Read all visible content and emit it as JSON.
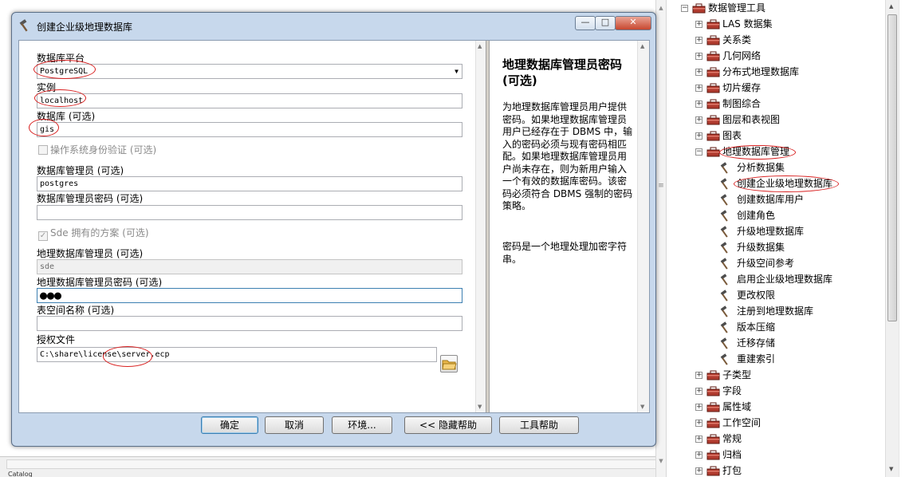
{
  "dialog": {
    "title": "创建企业级地理数据库",
    "window_buttons": {
      "minimize": "—",
      "maximize": "□",
      "close": "✕"
    },
    "fields": {
      "platform": {
        "label": "数据库平台",
        "value": "PostgreSQL"
      },
      "instance": {
        "label": "实例",
        "value": "localhost"
      },
      "database": {
        "label": "数据库 (可选)",
        "value": "gis"
      },
      "os_auth": {
        "label": "操作系统身份验证 (可选)",
        "checked": false
      },
      "db_admin": {
        "label": "数据库管理员 (可选)",
        "value": "postgres"
      },
      "db_admin_password": {
        "label": "数据库管理员密码 (可选)",
        "value": ""
      },
      "sde_schema": {
        "label": "Sde 拥有的方案 (可选)",
        "checked": true
      },
      "gdb_admin": {
        "label": "地理数据库管理员 (可选)",
        "value": "sde"
      },
      "gdb_admin_password": {
        "label": "地理数据库管理员密码 (可选)",
        "value": "●●●"
      },
      "tablespace": {
        "label": "表空间名称 (可选)",
        "value": ""
      },
      "license_file": {
        "label": "授权文件",
        "value": "C:\\share\\license\\server.ecp"
      }
    },
    "help": {
      "title": "地理数据库管理员密码 (可选)",
      "paragraph1": "为地理数据库管理员用户提供密码。如果地理数据库管理员用户已经存在于 DBMS 中，输入的密码必须与现有密码相匹配。如果地理数据库管理员用户尚未存在，则为新用户输入一个有效的数据库密码。该密码必须符合 DBMS 强制的密码策略。",
      "paragraph2": "密码是一个地理处理加密字符串。"
    },
    "buttons": {
      "ok": "确定",
      "cancel": "取消",
      "environments": "环境...",
      "hide_help": "<< 隐藏帮助",
      "tool_help": "工具帮助"
    }
  },
  "tree": {
    "root": "数据管理工具",
    "items_before": [
      "LAS 数据集",
      "关系类",
      "几何网络",
      "分布式地理数据库",
      "切片缓存",
      "制图综合",
      "图层和表视图",
      "图表"
    ],
    "expanded": "地理数据库管理",
    "tools": [
      "分析数据集",
      "创建企业级地理数据库",
      "创建数据库用户",
      "创建角色",
      "升级地理数据库",
      "升级数据集",
      "升级空间参考",
      "启用企业级地理数据库",
      "更改权限",
      "注册到地理数据库",
      "版本压缩",
      "迁移存储",
      "重建索引"
    ],
    "items_after": [
      "子类型",
      "字段",
      "属性域",
      "工作空间",
      "常规",
      "归档",
      "打包"
    ]
  },
  "bottom_tab": "Catalog",
  "colors": {
    "annotation": "#d81e1e",
    "titlebar": "#c7d8ec",
    "toolbox": "#b03a2e"
  }
}
